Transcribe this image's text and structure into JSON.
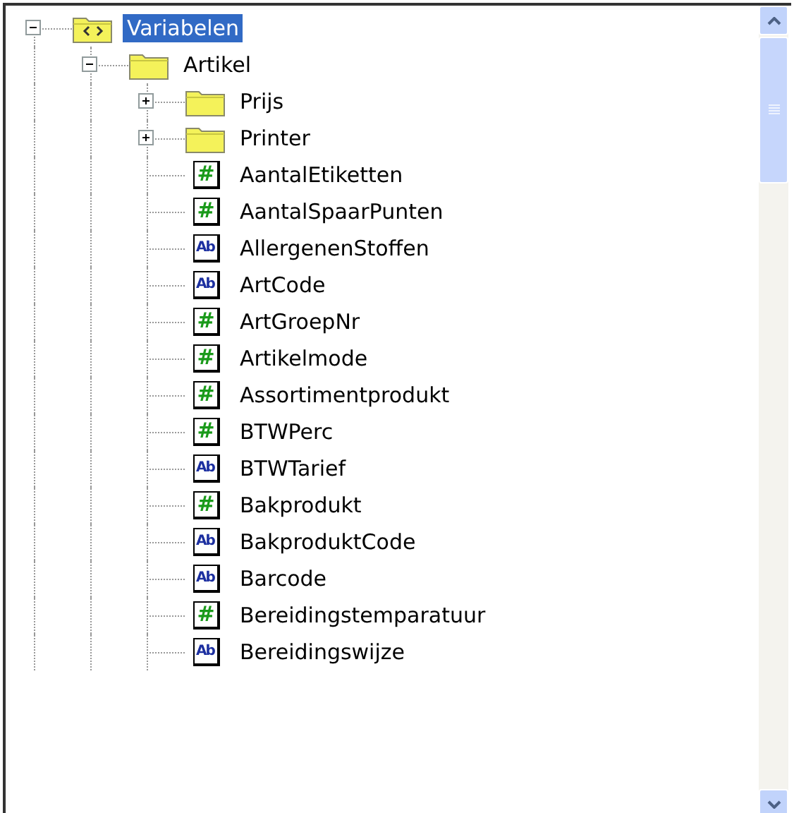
{
  "tree": [
    {
      "label": "Variabelen",
      "kind": "root",
      "expanded": true,
      "selected": true,
      "children": [
        {
          "label": "Artikel",
          "kind": "folder",
          "expanded": true,
          "selected": false,
          "children": [
            {
              "label": "Prijs",
              "kind": "folder",
              "expanded": false,
              "selected": false
            },
            {
              "label": "Printer",
              "kind": "folder",
              "expanded": false,
              "selected": false
            },
            {
              "label": "AantalEtiketten",
              "kind": "number",
              "badge": "#",
              "selected": false
            },
            {
              "label": "AantalSpaarPunten",
              "kind": "number",
              "badge": "#",
              "selected": false
            },
            {
              "label": "AllergenenStoffen",
              "kind": "text",
              "badge": "Ab",
              "selected": false
            },
            {
              "label": "ArtCode",
              "kind": "text",
              "badge": "Ab",
              "selected": false
            },
            {
              "label": "ArtGroepNr",
              "kind": "number",
              "badge": "#",
              "selected": false
            },
            {
              "label": "Artikelmode",
              "kind": "number",
              "badge": "#",
              "selected": false
            },
            {
              "label": "Assortimentprodukt",
              "kind": "number",
              "badge": "#",
              "selected": false
            },
            {
              "label": "BTWPerc",
              "kind": "number",
              "badge": "#",
              "selected": false
            },
            {
              "label": "BTWTarief",
              "kind": "text",
              "badge": "Ab",
              "selected": false
            },
            {
              "label": "Bakprodukt",
              "kind": "number",
              "badge": "#",
              "selected": false
            },
            {
              "label": "BakproduktCode",
              "kind": "text",
              "badge": "Ab",
              "selected": false
            },
            {
              "label": "Barcode",
              "kind": "text",
              "badge": "Ab",
              "selected": false
            },
            {
              "label": "Bereidingstemparatuur",
              "kind": "number",
              "badge": "#",
              "selected": false
            },
            {
              "label": "Bereidingswijze",
              "kind": "text",
              "badge": "Ab",
              "selected": false
            }
          ]
        }
      ]
    }
  ]
}
